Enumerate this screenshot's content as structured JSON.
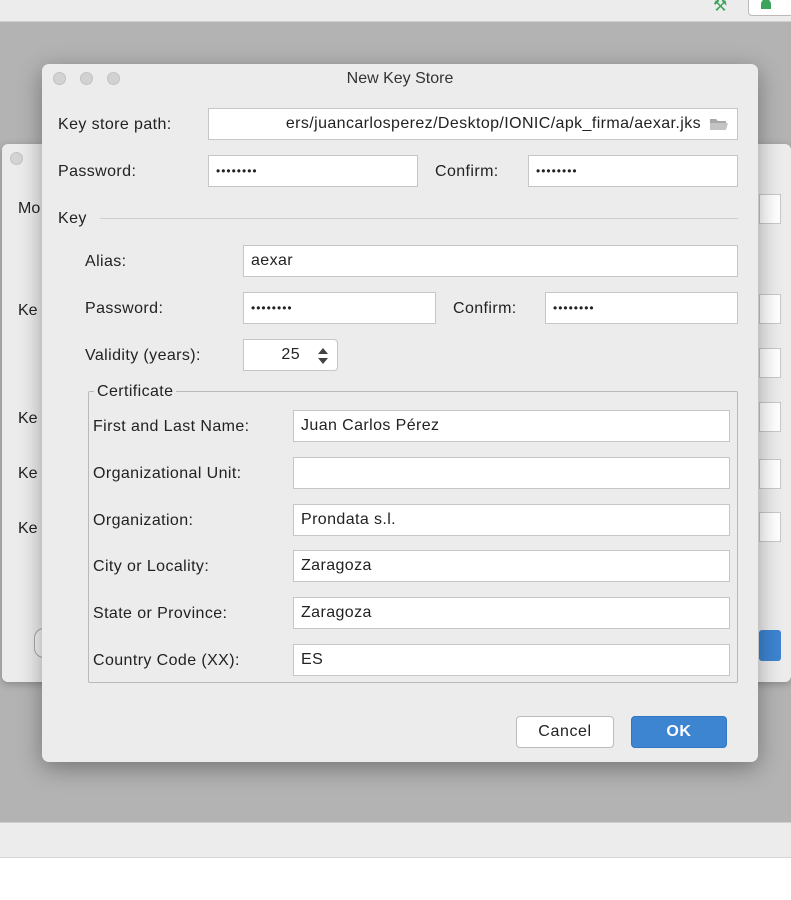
{
  "dialog": {
    "title": "New Key Store",
    "keystore_path_label": "Key store path:",
    "keystore_path_value": "ers/juancarlosperez/Desktop/IONIC/apk_firma/aexar.jks",
    "password_label": "Password:",
    "password_value": "••••••••",
    "confirm_label": "Confirm:",
    "confirm_value": "••••••••"
  },
  "key": {
    "section_label": "Key",
    "alias_label": "Alias:",
    "alias_value": "aexar",
    "password_label": "Password:",
    "password_value": "••••••••",
    "confirm_label": "Confirm:",
    "confirm_value": "••••••••",
    "validity_label": "Validity (years):",
    "validity_value": "25"
  },
  "certificate": {
    "title": "Certificate",
    "fields": [
      {
        "label": "First and Last Name:",
        "value": "Juan Carlos Pérez"
      },
      {
        "label": "Organizational Unit:",
        "value": ""
      },
      {
        "label": "Organization:",
        "value": "Prondata s.l."
      },
      {
        "label": "City or Locality:",
        "value": "Zaragoza"
      },
      {
        "label": "State or Province:",
        "value": "Zaragoza"
      },
      {
        "label": "Country Code (XX):",
        "value": "ES"
      }
    ]
  },
  "buttons": {
    "cancel": "Cancel",
    "ok": "OK"
  },
  "background_dialog": {
    "labels": [
      "Mo",
      "Ke",
      "Ke",
      "Ke",
      "Ke"
    ]
  },
  "colors": {
    "accent": "#3d84d1",
    "dialog_bg": "#ececec",
    "backdrop": "#b3b3b3"
  }
}
